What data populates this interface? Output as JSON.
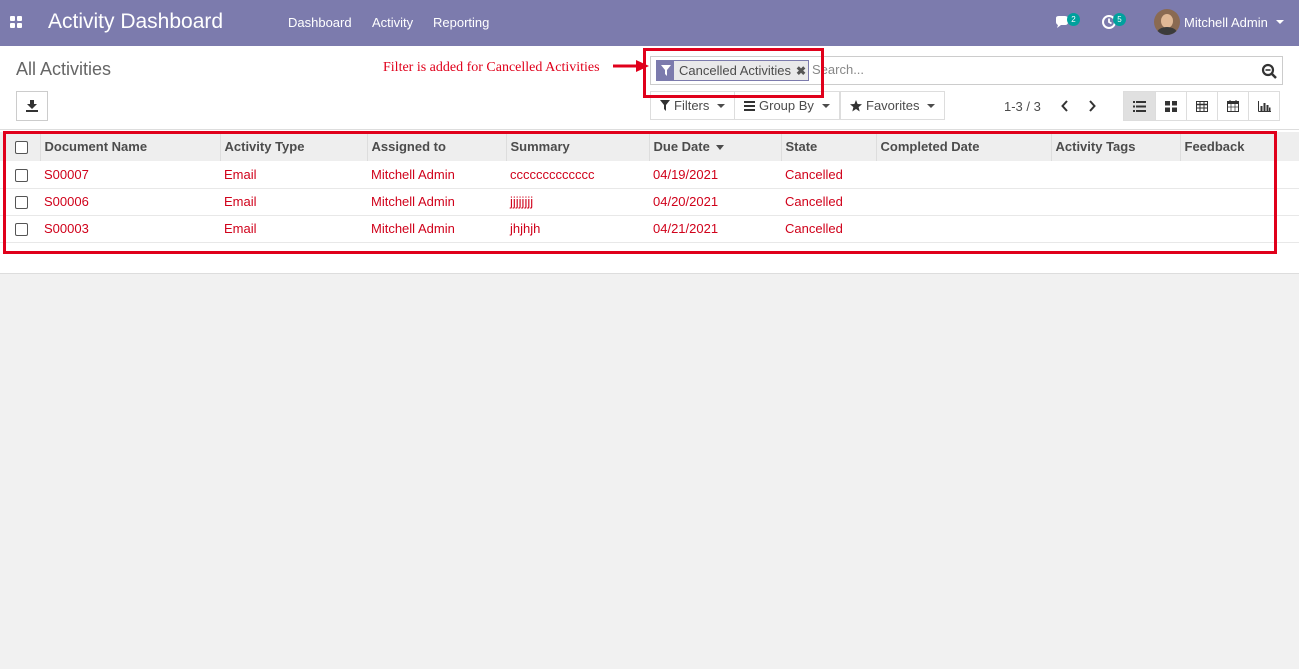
{
  "navbar": {
    "app_title": "Activity Dashboard",
    "menu": [
      "Dashboard",
      "Activity",
      "Reporting"
    ],
    "messages_count": "2",
    "activities_count": "5",
    "user_name": "Mitchell Admin"
  },
  "control_panel": {
    "breadcrumb": "All Activities",
    "annotation": "Filter is added for Cancelled Activities",
    "search": {
      "facet_label": "Cancelled Activities",
      "placeholder": "Search..."
    },
    "filters_label": "Filters",
    "group_by_label": "Group By",
    "favorites_label": "Favorites",
    "pager_value": "1-3 / 3"
  },
  "list": {
    "columns": [
      "Document Name",
      "Activity Type",
      "Assigned to",
      "Summary",
      "Due Date",
      "State",
      "Completed Date",
      "Activity Tags",
      "Feedback"
    ],
    "rows": [
      [
        "S00007",
        "Email",
        "Mitchell Admin",
        "ccccccccccccc",
        "04/19/2021",
        "Cancelled",
        "",
        "",
        ""
      ],
      [
        "S00006",
        "Email",
        "Mitchell Admin",
        "jjjjjjjj",
        "04/20/2021",
        "Cancelled",
        "",
        "",
        ""
      ],
      [
        "S00003",
        "Email",
        "Mitchell Admin",
        "jhjhjh",
        "04/21/2021",
        "Cancelled",
        "",
        "",
        ""
      ]
    ]
  },
  "colors": {
    "navbar": "#7c7bad",
    "row_text": "#d0021b",
    "annotation": "#e0001b",
    "badge": "#00a09d"
  }
}
